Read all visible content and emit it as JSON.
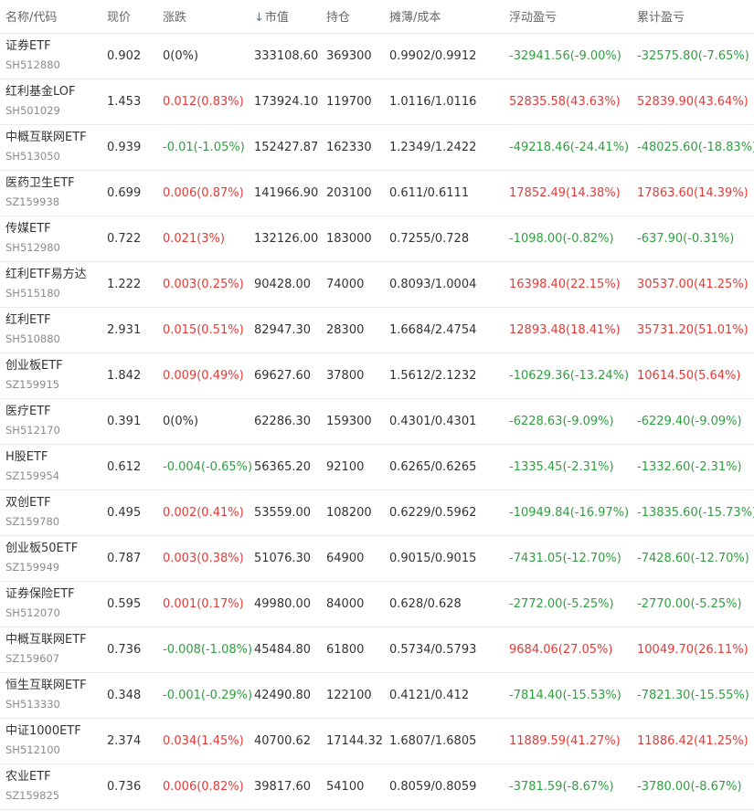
{
  "colors": {
    "up": "#e53935",
    "down": "#2e9f3e",
    "flat": "#333333",
    "sort_arrow": "#3b7bd6"
  },
  "header": {
    "name": "名称/代码",
    "price": "现价",
    "change": "涨跌",
    "sort_icon": "arrow-down-icon",
    "sort_arrow": "↓",
    "market_value": "市值",
    "holdings": "持仓",
    "cost": "摊薄/成本",
    "float_pl": "浮动盈亏",
    "total_pl": "累计盈亏"
  },
  "rows": [
    {
      "name": "证券ETF",
      "code": "SH512880",
      "price": "0.902",
      "change": "0(0%)",
      "market_value": "333108.60",
      "holdings": "369300",
      "cost": "0.9902/0.9912",
      "float_pl": "-32941.56(-9.00%)",
      "total_pl": "-32575.80(-7.65%)"
    },
    {
      "name": "红利基金LOF",
      "code": "SH501029",
      "price": "1.453",
      "change": "0.012(0.83%)",
      "market_value": "173924.10",
      "holdings": "119700",
      "cost": "1.0116/1.0116",
      "float_pl": "52835.58(43.63%)",
      "total_pl": "52839.90(43.64%)"
    },
    {
      "name": "中概互联网ETF",
      "code": "SH513050",
      "price": "0.939",
      "change": "-0.01(-1.05%)",
      "market_value": "152427.87",
      "holdings": "162330",
      "cost": "1.2349/1.2422",
      "float_pl": "-49218.46(-24.41%)",
      "total_pl": "-48025.60(-18.83%)"
    },
    {
      "name": "医药卫生ETF",
      "code": "SZ159938",
      "price": "0.699",
      "change": "0.006(0.87%)",
      "market_value": "141966.90",
      "holdings": "203100",
      "cost": "0.611/0.6111",
      "float_pl": "17852.49(14.38%)",
      "total_pl": "17863.60(14.39%)"
    },
    {
      "name": "传媒ETF",
      "code": "SH512980",
      "price": "0.722",
      "change": "0.021(3%)",
      "market_value": "132126.00",
      "holdings": "183000",
      "cost": "0.7255/0.728",
      "float_pl": "-1098.00(-0.82%)",
      "total_pl": "-637.90(-0.31%)"
    },
    {
      "name": "红利ETF易方达",
      "code": "SH515180",
      "price": "1.222",
      "change": "0.003(0.25%)",
      "market_value": "90428.00",
      "holdings": "74000",
      "cost": "0.8093/1.0004",
      "float_pl": "16398.40(22.15%)",
      "total_pl": "30537.00(41.25%)"
    },
    {
      "name": "红利ETF",
      "code": "SH510880",
      "price": "2.931",
      "change": "0.015(0.51%)",
      "market_value": "82947.30",
      "holdings": "28300",
      "cost": "1.6684/2.4754",
      "float_pl": "12893.48(18.41%)",
      "total_pl": "35731.20(51.01%)"
    },
    {
      "name": "创业板ETF",
      "code": "SZ159915",
      "price": "1.842",
      "change": "0.009(0.49%)",
      "market_value": "69627.60",
      "holdings": "37800",
      "cost": "1.5612/2.1232",
      "float_pl": "-10629.36(-13.24%)",
      "total_pl": "10614.50(5.64%)"
    },
    {
      "name": "医疗ETF",
      "code": "SH512170",
      "price": "0.391",
      "change": "0(0%)",
      "market_value": "62286.30",
      "holdings": "159300",
      "cost": "0.4301/0.4301",
      "float_pl": "-6228.63(-9.09%)",
      "total_pl": "-6229.40(-9.09%)"
    },
    {
      "name": "H股ETF",
      "code": "SZ159954",
      "price": "0.612",
      "change": "-0.004(-0.65%)",
      "market_value": "56365.20",
      "holdings": "92100",
      "cost": "0.6265/0.6265",
      "float_pl": "-1335.45(-2.31%)",
      "total_pl": "-1332.60(-2.31%)"
    },
    {
      "name": "双创ETF",
      "code": "SZ159780",
      "price": "0.495",
      "change": "0.002(0.41%)",
      "market_value": "53559.00",
      "holdings": "108200",
      "cost": "0.6229/0.5962",
      "float_pl": "-10949.84(-16.97%)",
      "total_pl": "-13835.60(-15.73%)"
    },
    {
      "name": "创业板50ETF",
      "code": "SZ159949",
      "price": "0.787",
      "change": "0.003(0.38%)",
      "market_value": "51076.30",
      "holdings": "64900",
      "cost": "0.9015/0.9015",
      "float_pl": "-7431.05(-12.70%)",
      "total_pl": "-7428.60(-12.70%)"
    },
    {
      "name": "证券保险ETF",
      "code": "SH512070",
      "price": "0.595",
      "change": "0.001(0.17%)",
      "market_value": "49980.00",
      "holdings": "84000",
      "cost": "0.628/0.628",
      "float_pl": "-2772.00(-5.25%)",
      "total_pl": "-2770.00(-5.25%)"
    },
    {
      "name": "中概互联网ETF",
      "code": "SZ159607",
      "price": "0.736",
      "change": "-0.008(-1.08%)",
      "market_value": "45484.80",
      "holdings": "61800",
      "cost": "0.5734/0.5793",
      "float_pl": "9684.06(27.05%)",
      "total_pl": "10049.70(26.11%)"
    },
    {
      "name": "恒生互联网ETF",
      "code": "SH513330",
      "price": "0.348",
      "change": "-0.001(-0.29%)",
      "market_value": "42490.80",
      "holdings": "122100",
      "cost": "0.4121/0.412",
      "float_pl": "-7814.40(-15.53%)",
      "total_pl": "-7821.30(-15.55%)"
    },
    {
      "name": "中证1000ETF",
      "code": "SH512100",
      "price": "2.374",
      "change": "0.034(1.45%)",
      "market_value": "40700.62",
      "holdings": "17144.32",
      "cost": "1.6807/1.6805",
      "float_pl": "11889.59(41.27%)",
      "total_pl": "11886.42(41.25%)"
    },
    {
      "name": "农业ETF",
      "code": "SZ159825",
      "price": "0.736",
      "change": "0.006(0.82%)",
      "market_value": "39817.60",
      "holdings": "54100",
      "cost": "0.8059/0.8059",
      "float_pl": "-3781.59(-8.67%)",
      "total_pl": "-3780.00(-8.67%)"
    }
  ]
}
